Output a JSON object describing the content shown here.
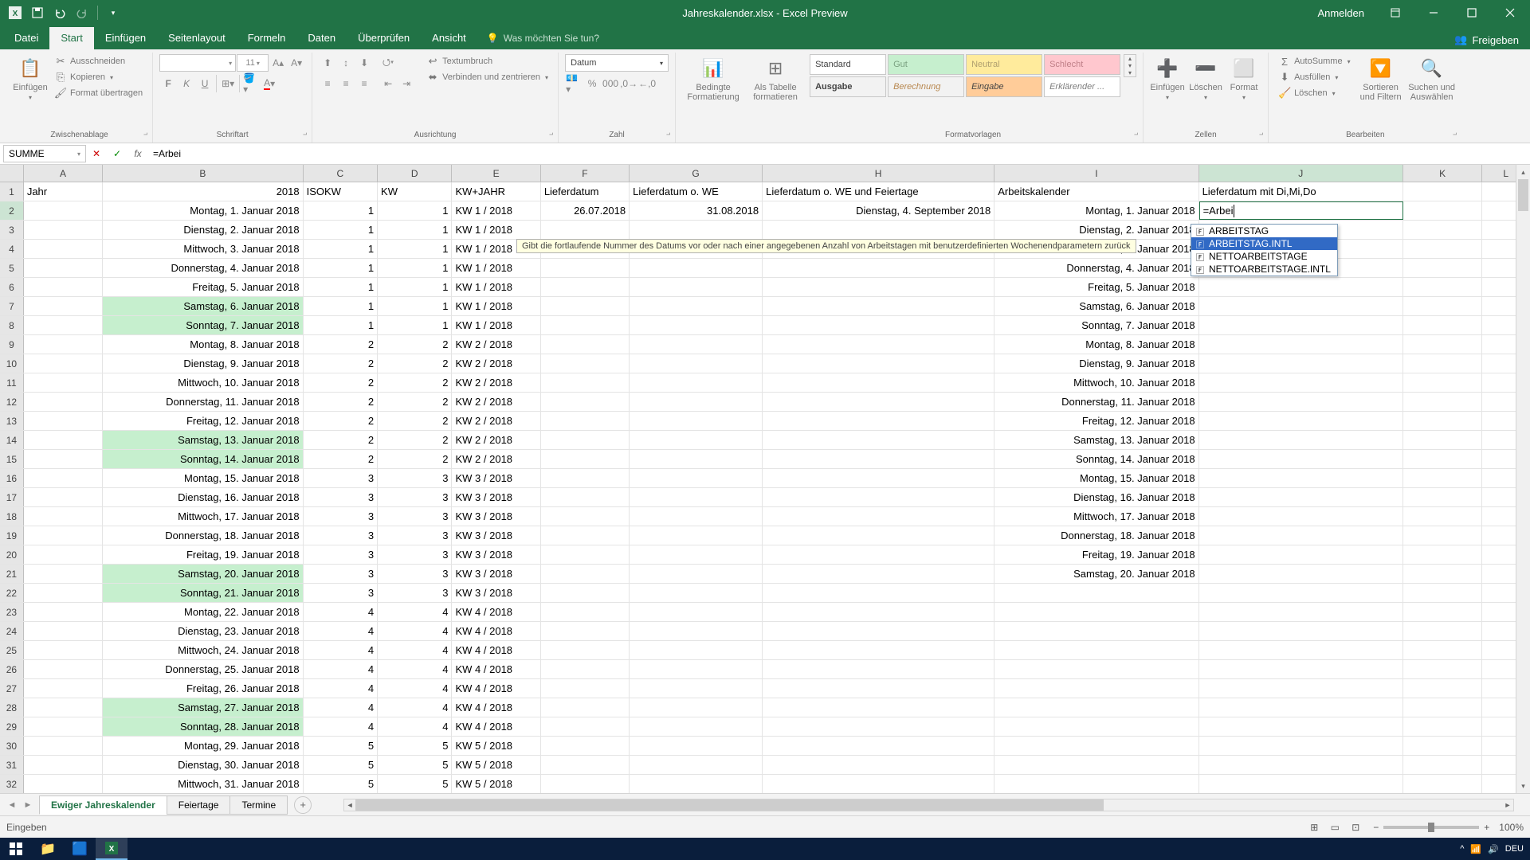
{
  "app": {
    "title": "Jahreskalender.xlsx - Excel Preview",
    "signin": "Anmelden"
  },
  "ribbon_tabs": {
    "file": "Datei",
    "start": "Start",
    "einfuegen": "Einfügen",
    "seitenlayout": "Seitenlayout",
    "formeln": "Formeln",
    "daten": "Daten",
    "ueberpruefen": "Überprüfen",
    "ansicht": "Ansicht",
    "tellme": "Was möchten Sie tun?",
    "share": "Freigeben"
  },
  "ribbon": {
    "clipboard": {
      "label": "Zwischenablage",
      "paste": "Einfügen",
      "cut": "Ausschneiden",
      "copy": "Kopieren",
      "format": "Format übertragen"
    },
    "font": {
      "label": "Schriftart",
      "size": "11"
    },
    "align": {
      "label": "Ausrichtung",
      "wrap": "Textumbruch",
      "merge": "Verbinden und zentrieren"
    },
    "number": {
      "label": "Zahl",
      "format": "Datum"
    },
    "cond": {
      "cond": "Bedingte Formatierung",
      "table": "Als Tabelle formatieren"
    },
    "styles": {
      "label": "Formatvorlagen",
      "standard": "Standard",
      "gut": "Gut",
      "neutral": "Neutral",
      "schlecht": "Schlecht",
      "ausgabe": "Ausgabe",
      "berechnung": "Berechnung",
      "eingabe": "Eingabe",
      "erklar": "Erklärender ..."
    },
    "cells": {
      "label": "Zellen",
      "insert": "Einfügen",
      "delete": "Löschen",
      "format": "Format"
    },
    "editing": {
      "label": "Bearbeiten",
      "autosum": "AutoSumme",
      "fill": "Ausfüllen",
      "clear": "Löschen",
      "sort": "Sortieren und Filtern",
      "find": "Suchen und Auswählen"
    }
  },
  "formula_bar": {
    "name_box": "SUMME",
    "formula": "=Arbei"
  },
  "columns": [
    "A",
    "B",
    "C",
    "D",
    "E",
    "F",
    "G",
    "H",
    "I",
    "J",
    "K",
    "L"
  ],
  "headers": {
    "A": "Jahr",
    "B_year": "2018",
    "C": "ISOKW",
    "D": "KW",
    "E": "KW+JAHR",
    "F": "Lieferdatum",
    "G": "Lieferdatum o. WE",
    "H": "Lieferdatum o. WE und Feiertage",
    "I": "Arbeitskalender",
    "J": "Lieferdatum mit Di,Mi,Do"
  },
  "cell_edit": "=Arbei",
  "autocomplete": {
    "tooltip": "Gibt die fortlaufende Nummer des Datums vor oder nach einer angegebenen Anzahl von Arbeitstagen mit benutzerdefinierten Wochenendparametern zurück",
    "items": [
      "ARBEITSTAG",
      "ARBEITSTAG.INTL",
      "NETTOARBEITSTAGE",
      "NETTOARBEITSTAGE.INTL"
    ],
    "selected_index": 1
  },
  "rows": [
    {
      "n": 2,
      "date": "Montag, 1. Januar 2018",
      "iso": 1,
      "kw": 1,
      "kwj": "KW 1 / 2018",
      "f": "26.07.2018",
      "g": "31.08.2018",
      "h": "Dienstag, 4. September 2018",
      "i": "Montag, 1. Januar 2018",
      "we": false
    },
    {
      "n": 3,
      "date": "Dienstag, 2. Januar 2018",
      "iso": 1,
      "kw": 1,
      "kwj": "KW 1 / 2018",
      "f": "",
      "g": "",
      "h": "",
      "i": "Dienstag, 2. Januar 2018",
      "we": false
    },
    {
      "n": 4,
      "date": "Mittwoch, 3. Januar 2018",
      "iso": 1,
      "kw": 1,
      "kwj": "KW 1 / 2018",
      "f": "",
      "g": "",
      "h": "",
      "i": "Mittwoch, 3. Januar 2018",
      "we": false
    },
    {
      "n": 5,
      "date": "Donnerstag, 4. Januar 2018",
      "iso": 1,
      "kw": 1,
      "kwj": "KW 1 / 2018",
      "f": "",
      "g": "",
      "h": "",
      "i": "Donnerstag, 4. Januar 2018",
      "we": false
    },
    {
      "n": 6,
      "date": "Freitag, 5. Januar 2018",
      "iso": 1,
      "kw": 1,
      "kwj": "KW 1 / 2018",
      "f": "",
      "g": "",
      "h": "",
      "i": "Freitag, 5. Januar 2018",
      "we": false
    },
    {
      "n": 7,
      "date": "Samstag, 6. Januar 2018",
      "iso": 1,
      "kw": 1,
      "kwj": "KW 1 / 2018",
      "f": "",
      "g": "",
      "h": "",
      "i": "Samstag, 6. Januar 2018",
      "we": true
    },
    {
      "n": 8,
      "date": "Sonntag, 7. Januar 2018",
      "iso": 1,
      "kw": 1,
      "kwj": "KW 1 / 2018",
      "f": "",
      "g": "",
      "h": "",
      "i": "Sonntag, 7. Januar 2018",
      "we": true
    },
    {
      "n": 9,
      "date": "Montag, 8. Januar 2018",
      "iso": 2,
      "kw": 2,
      "kwj": "KW 2 / 2018",
      "f": "",
      "g": "",
      "h": "",
      "i": "Montag, 8. Januar 2018",
      "we": false
    },
    {
      "n": 10,
      "date": "Dienstag, 9. Januar 2018",
      "iso": 2,
      "kw": 2,
      "kwj": "KW 2 / 2018",
      "f": "",
      "g": "",
      "h": "",
      "i": "Dienstag, 9. Januar 2018",
      "we": false
    },
    {
      "n": 11,
      "date": "Mittwoch, 10. Januar 2018",
      "iso": 2,
      "kw": 2,
      "kwj": "KW 2 / 2018",
      "f": "",
      "g": "",
      "h": "",
      "i": "Mittwoch, 10. Januar 2018",
      "we": false
    },
    {
      "n": 12,
      "date": "Donnerstag, 11. Januar 2018",
      "iso": 2,
      "kw": 2,
      "kwj": "KW 2 / 2018",
      "f": "",
      "g": "",
      "h": "",
      "i": "Donnerstag, 11. Januar 2018",
      "we": false
    },
    {
      "n": 13,
      "date": "Freitag, 12. Januar 2018",
      "iso": 2,
      "kw": 2,
      "kwj": "KW 2 / 2018",
      "f": "",
      "g": "",
      "h": "",
      "i": "Freitag, 12. Januar 2018",
      "we": false
    },
    {
      "n": 14,
      "date": "Samstag, 13. Januar 2018",
      "iso": 2,
      "kw": 2,
      "kwj": "KW 2 / 2018",
      "f": "",
      "g": "",
      "h": "",
      "i": "Samstag, 13. Januar 2018",
      "we": true
    },
    {
      "n": 15,
      "date": "Sonntag, 14. Januar 2018",
      "iso": 2,
      "kw": 2,
      "kwj": "KW 2 / 2018",
      "f": "",
      "g": "",
      "h": "",
      "i": "Sonntag, 14. Januar 2018",
      "we": true
    },
    {
      "n": 16,
      "date": "Montag, 15. Januar 2018",
      "iso": 3,
      "kw": 3,
      "kwj": "KW 3 / 2018",
      "f": "",
      "g": "",
      "h": "",
      "i": "Montag, 15. Januar 2018",
      "we": false
    },
    {
      "n": 17,
      "date": "Dienstag, 16. Januar 2018",
      "iso": 3,
      "kw": 3,
      "kwj": "KW 3 / 2018",
      "f": "",
      "g": "",
      "h": "",
      "i": "Dienstag, 16. Januar 2018",
      "we": false
    },
    {
      "n": 18,
      "date": "Mittwoch, 17. Januar 2018",
      "iso": 3,
      "kw": 3,
      "kwj": "KW 3 / 2018",
      "f": "",
      "g": "",
      "h": "",
      "i": "Mittwoch, 17. Januar 2018",
      "we": false
    },
    {
      "n": 19,
      "date": "Donnerstag, 18. Januar 2018",
      "iso": 3,
      "kw": 3,
      "kwj": "KW 3 / 2018",
      "f": "",
      "g": "",
      "h": "",
      "i": "Donnerstag, 18. Januar 2018",
      "we": false
    },
    {
      "n": 20,
      "date": "Freitag, 19. Januar 2018",
      "iso": 3,
      "kw": 3,
      "kwj": "KW 3 / 2018",
      "f": "",
      "g": "",
      "h": "",
      "i": "Freitag, 19. Januar 2018",
      "we": false
    },
    {
      "n": 21,
      "date": "Samstag, 20. Januar 2018",
      "iso": 3,
      "kw": 3,
      "kwj": "KW 3 / 2018",
      "f": "",
      "g": "",
      "h": "",
      "i": "Samstag, 20. Januar 2018",
      "we": true
    },
    {
      "n": 22,
      "date": "Sonntag, 21. Januar 2018",
      "iso": 3,
      "kw": 3,
      "kwj": "KW 3 / 2018",
      "f": "",
      "g": "",
      "h": "",
      "i": "",
      "we": true
    },
    {
      "n": 23,
      "date": "Montag, 22. Januar 2018",
      "iso": 4,
      "kw": 4,
      "kwj": "KW 4 / 2018",
      "f": "",
      "g": "",
      "h": "",
      "i": "",
      "we": false
    },
    {
      "n": 24,
      "date": "Dienstag, 23. Januar 2018",
      "iso": 4,
      "kw": 4,
      "kwj": "KW 4 / 2018",
      "f": "",
      "g": "",
      "h": "",
      "i": "",
      "we": false
    },
    {
      "n": 25,
      "date": "Mittwoch, 24. Januar 2018",
      "iso": 4,
      "kw": 4,
      "kwj": "KW 4 / 2018",
      "f": "",
      "g": "",
      "h": "",
      "i": "",
      "we": false
    },
    {
      "n": 26,
      "date": "Donnerstag, 25. Januar 2018",
      "iso": 4,
      "kw": 4,
      "kwj": "KW 4 / 2018",
      "f": "",
      "g": "",
      "h": "",
      "i": "",
      "we": false
    },
    {
      "n": 27,
      "date": "Freitag, 26. Januar 2018",
      "iso": 4,
      "kw": 4,
      "kwj": "KW 4 / 2018",
      "f": "",
      "g": "",
      "h": "",
      "i": "",
      "we": false
    },
    {
      "n": 28,
      "date": "Samstag, 27. Januar 2018",
      "iso": 4,
      "kw": 4,
      "kwj": "KW 4 / 2018",
      "f": "",
      "g": "",
      "h": "",
      "i": "",
      "we": true
    },
    {
      "n": 29,
      "date": "Sonntag, 28. Januar 2018",
      "iso": 4,
      "kw": 4,
      "kwj": "KW 4 / 2018",
      "f": "",
      "g": "",
      "h": "",
      "i": "",
      "we": true
    },
    {
      "n": 30,
      "date": "Montag, 29. Januar 2018",
      "iso": 5,
      "kw": 5,
      "kwj": "KW 5 / 2018",
      "f": "",
      "g": "",
      "h": "",
      "i": "",
      "we": false
    },
    {
      "n": 31,
      "date": "Dienstag, 30. Januar 2018",
      "iso": 5,
      "kw": 5,
      "kwj": "KW 5 / 2018",
      "f": "",
      "g": "",
      "h": "",
      "i": "",
      "we": false
    },
    {
      "n": 32,
      "date": "Mittwoch, 31. Januar 2018",
      "iso": 5,
      "kw": 5,
      "kwj": "KW 5 / 2018",
      "f": "",
      "g": "",
      "h": "",
      "i": "",
      "we": false
    }
  ],
  "sheets": {
    "active": "Ewiger Jahreskalender",
    "tabs": [
      "Ewiger Jahreskalender",
      "Feiertage",
      "Termine"
    ]
  },
  "statusbar": {
    "mode": "Eingeben",
    "zoom": "100%"
  },
  "taskbar": {
    "time": ""
  }
}
